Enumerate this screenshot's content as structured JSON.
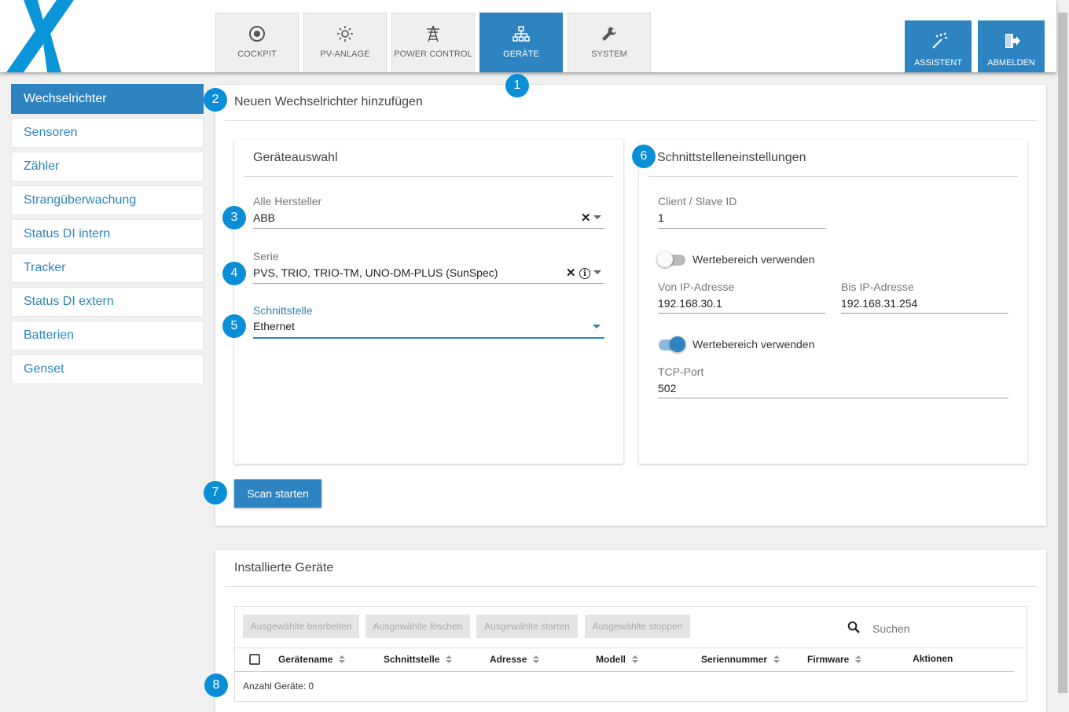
{
  "nav": {
    "tabs": [
      {
        "label": "COCKPIT",
        "icon": "target-icon"
      },
      {
        "label": "PV-ANLAGE",
        "icon": "sun-icon"
      },
      {
        "label": "POWER CONTROL",
        "icon": "power-tower-icon"
      },
      {
        "label": "GERÄTE",
        "icon": "network-icon"
      },
      {
        "label": "SYSTEM",
        "icon": "wrench-icon"
      }
    ],
    "active_tab": "GERÄTE",
    "actions": [
      {
        "label": "ASSISTENT",
        "icon": "magic-wand-icon"
      },
      {
        "label": "ABMELDEN",
        "icon": "logout-icon"
      }
    ]
  },
  "sidebar": {
    "items": [
      {
        "label": "Wechselrichter"
      },
      {
        "label": "Sensoren"
      },
      {
        "label": "Zähler"
      },
      {
        "label": "Strangüberwachung"
      },
      {
        "label": "Status DI intern"
      },
      {
        "label": "Tracker"
      },
      {
        "label": "Status DI extern"
      },
      {
        "label": "Batterien"
      },
      {
        "label": "Genset"
      }
    ],
    "active": "Wechselrichter"
  },
  "badges": [
    "1",
    "2",
    "3",
    "4",
    "5",
    "6",
    "7",
    "8"
  ],
  "add_panel": {
    "title": "Neuen Wechselrichter hinzufügen",
    "device_selection": {
      "title": "Geräteauswahl",
      "manufacturer": {
        "label": "Alle Hersteller",
        "value": "ABB"
      },
      "series": {
        "label": "Serie",
        "value": "PVS, TRIO, TRIO-TM, UNO-DM-PLUS (SunSpec)"
      },
      "interface": {
        "label": "Schnittstelle",
        "value": "Ethernet"
      }
    },
    "interface_settings": {
      "title": "Schnittstelleneinstellungen",
      "client_id": {
        "label": "Client / Slave ID",
        "value": "1"
      },
      "range_toggle_1": {
        "label": "Wertebereich verwenden",
        "on": false
      },
      "ip_from": {
        "label": "Von IP-Adresse",
        "value": "192.168.30.1"
      },
      "ip_to": {
        "label": "Bis IP-Adresse",
        "value": "192.168.31.254"
      },
      "range_toggle_2": {
        "label": "Wertebereich verwenden",
        "on": true
      },
      "tcp_port": {
        "label": "TCP-Port",
        "value": "502"
      }
    },
    "scan_button": "Scan starten"
  },
  "installed": {
    "title": "Installierte Geräte",
    "toolbar": [
      "Ausgewählte bearbeiten",
      "Ausgewählte löschen",
      "Ausgewählte starten",
      "Ausgewählte stoppen"
    ],
    "search_placeholder": "Suchen",
    "columns": [
      "Gerätename",
      "Schnittstelle",
      "Adresse",
      "Modell",
      "Seriennummer",
      "Firmware",
      "Aktionen"
    ],
    "count_text": "Anzahl Geräte: 0"
  },
  "colors": {
    "accent": "#2d84c0",
    "badge": "#0a8fd6",
    "logo": "#0a95d8"
  }
}
